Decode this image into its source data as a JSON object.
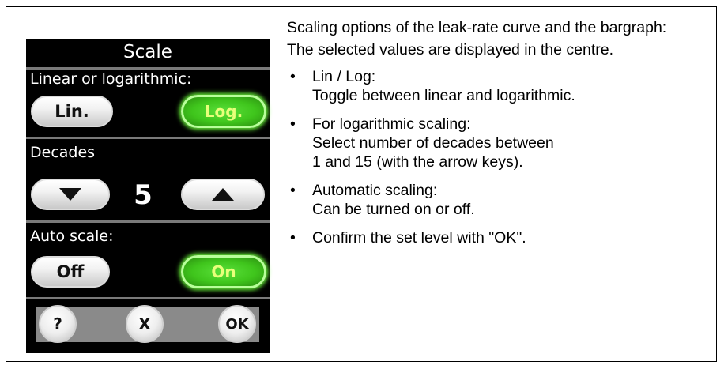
{
  "screen": {
    "title": "Scale",
    "linear_log_label": "Linear or logarithmic:",
    "lin_button": "Lin.",
    "log_button": "Log.",
    "decades_label": "Decades",
    "decades_value": "5",
    "down_icon": "triangle-down-icon",
    "up_icon": "triangle-up-icon",
    "autoscale_label": "Auto scale:",
    "off_button": "Off",
    "on_button": "On",
    "help_button": "?",
    "cancel_button": "X",
    "ok_button": "OK",
    "active_color": "#3fc51c",
    "active_text_color": "#e8ff7a"
  },
  "description": {
    "intro_1": "Scaling options of the leak-rate curve and the bargraph:",
    "intro_2": "The selected values are displayed in the centre.",
    "bullet_char": "•",
    "bullets": [
      {
        "line1": "Lin / Log:",
        "line2": "Toggle between linear and logarithmic.",
        "line3": ""
      },
      {
        "line1": "For logarithmic scaling:",
        "line2": "Select number of decades between",
        "line3": "1 and 15 (with the arrow keys)."
      },
      {
        "line1": "Automatic scaling:",
        "line2": "Can be turned on or off.",
        "line3": ""
      },
      {
        "line1": "Confirm the set level with \"OK\".",
        "line2": "",
        "line3": ""
      }
    ]
  }
}
